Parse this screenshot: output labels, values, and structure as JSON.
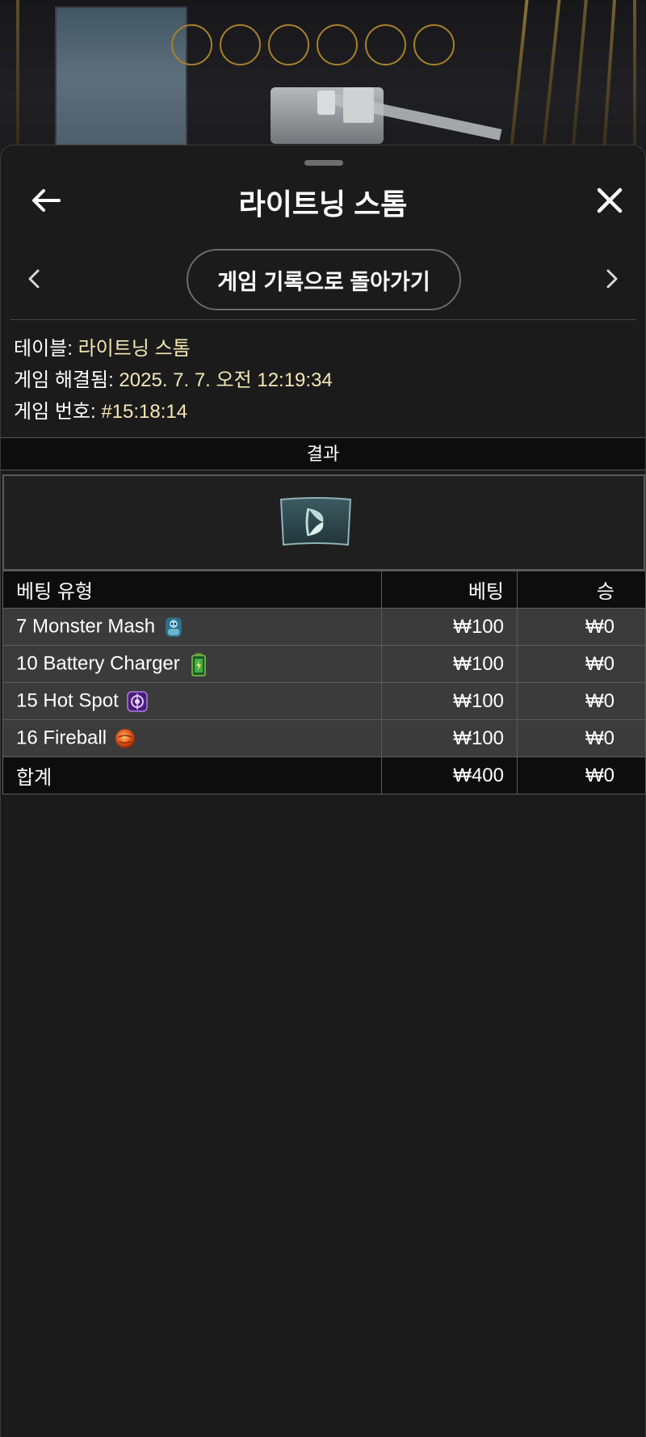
{
  "sheet": {
    "title": "라이트닝 스톰",
    "back_to_history_label": "게임 기록으로 돌아가기",
    "info": {
      "table_label": "테이블:",
      "table_value": "라이트닝 스톰",
      "resolved_label": "게임 해결됨:",
      "resolved_value": "2025. 7. 7. 오전 12:19:34",
      "game_no_label": "게임 번호:",
      "game_no_value": "#15:18:14"
    }
  },
  "result": {
    "header": "결과",
    "card_icon": "result-card-leaf-icon"
  },
  "bets": {
    "col_type": "베팅 유형",
    "col_bet": "베팅",
    "col_win": "승",
    "rows": [
      {
        "type": "7 Monster Mash",
        "icon": "monster-icon",
        "bet": "₩100",
        "win": "₩0"
      },
      {
        "type": "10 Battery Charger",
        "icon": "battery-icon",
        "bet": "₩100",
        "win": "₩0"
      },
      {
        "type": "15 Hot Spot",
        "icon": "hot-spot-icon",
        "bet": "₩100",
        "win": "₩0"
      },
      {
        "type": "16 Fireball",
        "icon": "fireball-icon",
        "bet": "₩100",
        "win": "₩0"
      }
    ],
    "total": {
      "label": "합계",
      "bet": "₩400",
      "win": "₩0"
    }
  },
  "colors": {
    "accent_value": "#f4e7b4",
    "ring_gold": "#a8802d",
    "sheet_bg": "#1b1b1b"
  },
  "icons": {
    "back": "arrow-left-icon",
    "close": "close-x-icon",
    "prev": "chevron-left-icon",
    "next": "chevron-right-icon"
  }
}
